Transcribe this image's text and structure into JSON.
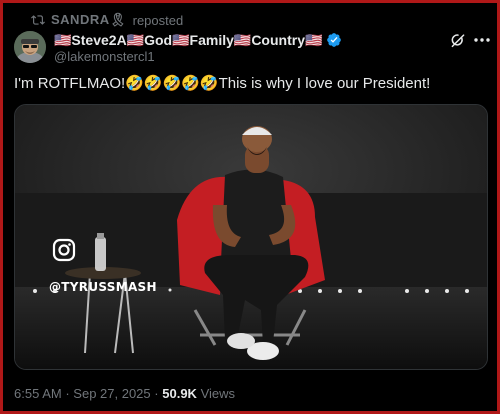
{
  "repost": {
    "name": "SANDRA🎗",
    "label": "reposted"
  },
  "author": {
    "display_name": "🇺🇸Steve2A🇺🇸God🇺🇸Family🇺🇸Country🇺🇸",
    "handle": "@lakemonstercl1",
    "verified": true
  },
  "tweet": {
    "text": "I'm ROTFLMAO!🤣🤣🤣🤣🤣This is why I love our President!"
  },
  "media": {
    "watermark": "@TYRUSSMASH",
    "watermark_icon": "instagram-icon"
  },
  "meta": {
    "time": "6:55 AM",
    "separator": "·",
    "date": "Sep 27, 2025",
    "views_count": "50.9K",
    "views_label": "Views"
  },
  "colors": {
    "border": "#b01818",
    "verified": "#1d9bf0",
    "text": "#e7e9ea",
    "muted": "#71767b"
  }
}
